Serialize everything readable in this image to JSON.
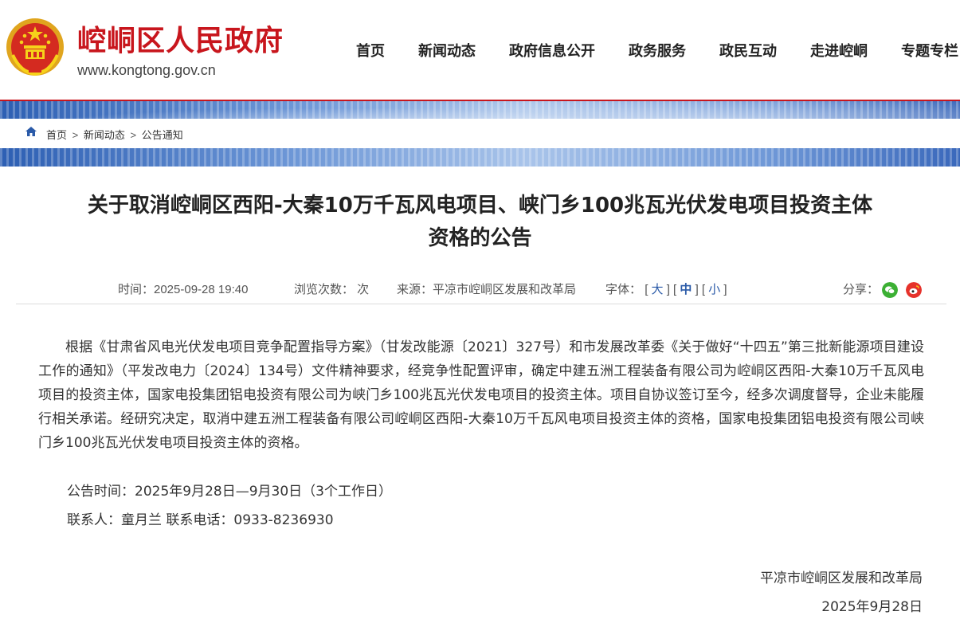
{
  "site": {
    "name": "崆峒区人民政府",
    "domain": "www.kongtong.gov.cn"
  },
  "nav": [
    "首页",
    "新闻动态",
    "政府信息公开",
    "政务服务",
    "政民互动",
    "走进崆峒",
    "专题专栏"
  ],
  "breadcrumb": [
    "首页",
    "新闻动态",
    "公告通知"
  ],
  "breadcrumb_sep": ">",
  "article": {
    "title_line1": "关于取消崆峒区西阳-大秦10万千瓦风电项目、峡门乡100兆瓦光伏发电项目投资主体",
    "title_line2": "资格的公告",
    "meta": {
      "time": "时间：2025-09-28 19:40",
      "views": "浏览次数： 次",
      "source": "来源：平凉市崆峒区发展和改革局",
      "font_label": "字体：",
      "font_large": "大",
      "font_medium": "中",
      "font_small": "小",
      "share_label": "分享："
    },
    "paragraph": "根据《甘肃省风电光伏发电项目竞争配置指导方案》（甘发改能源〔2021〕327号）和市发展改革委《关于做好“十四五”第三批新能源项目建设工作的通知》（平发改电力〔2024〕134号）文件精神要求，经竞争性配置评审，确定中建五洲工程装备有限公司为崆峒区西阳-大秦10万千瓦风电项目的投资主体，国家电投集团铝电投资有限公司为峡门乡100兆瓦光伏发电项目的投资主体。项目自协议签订至今，经多次调度督导，企业未能履行相关承诺。经研究决定，取消中建五洲工程装备有限公司崆峒区西阳-大秦10万千瓦风电项目投资主体的资格，国家电投集团铝电投资有限公司峡门乡100兆瓦光伏发电项目投资主体的资格。",
    "notice_period": "公告时间：2025年9月28日—9月30日（3个工作日）",
    "contact": "联系人：童月兰  联系电话：0933-8236930",
    "signature_org": "平凉市崆峒区发展和改革局",
    "signature_date": "2025年9月28日"
  },
  "colors": {
    "brand_red": "#c8161d",
    "link_blue": "#2a5aa8",
    "wechat_green": "#3cb034",
    "weibo_red": "#e6322b"
  },
  "icons": {
    "emblem": "national-emblem-icon",
    "home": "home-icon",
    "wechat": "wechat-icon",
    "weibo": "weibo-icon"
  }
}
